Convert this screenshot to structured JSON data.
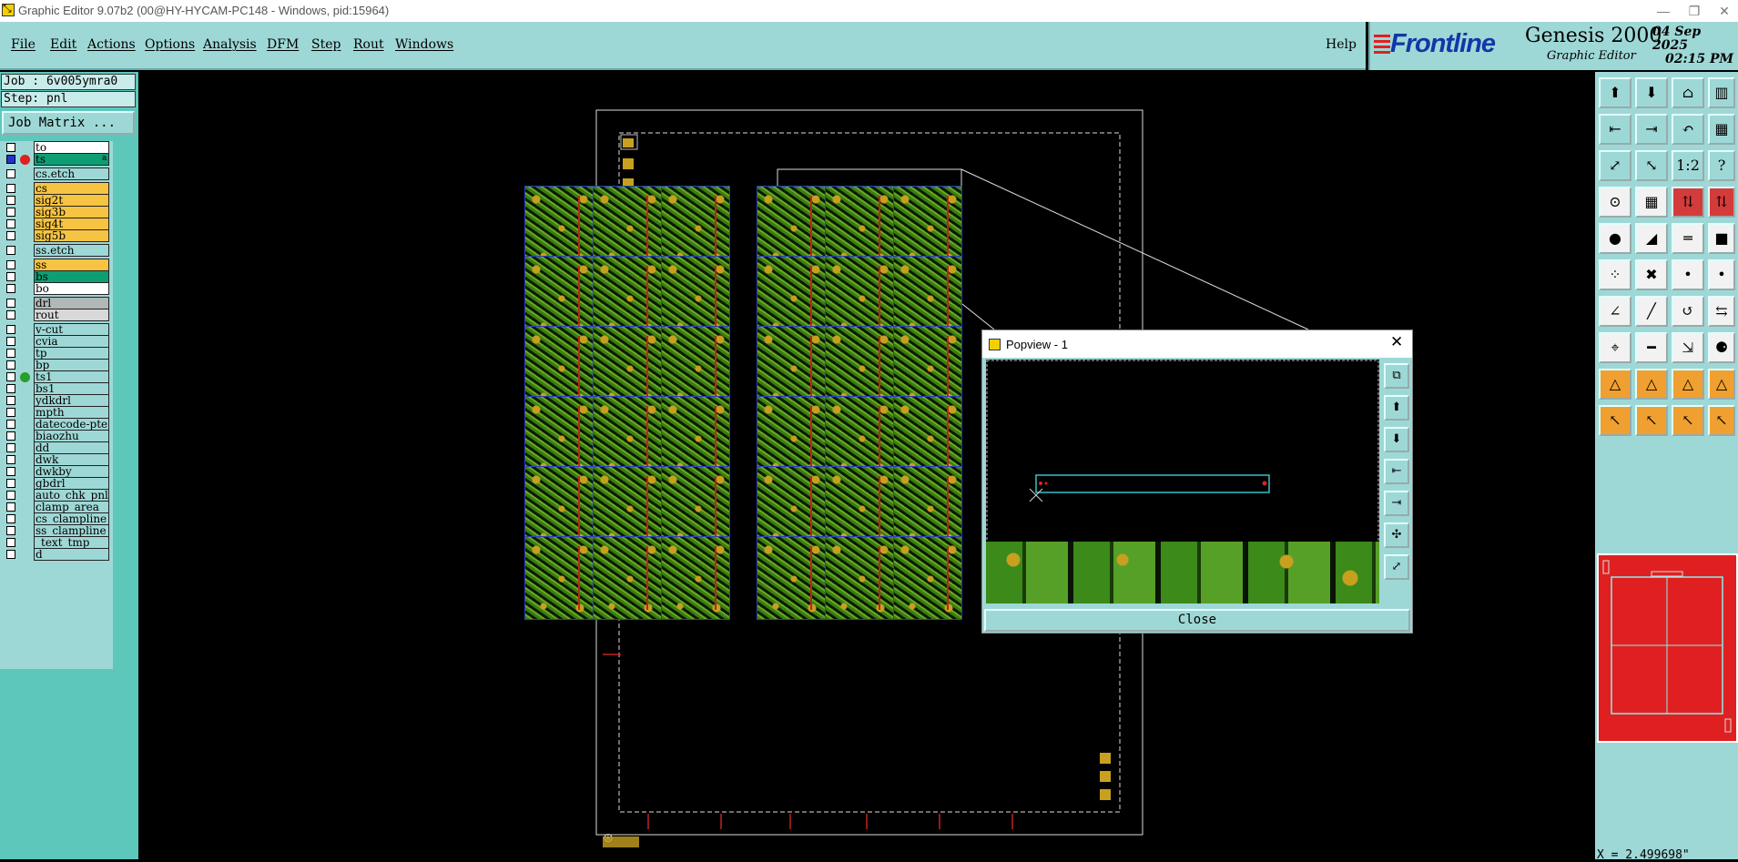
{
  "window": {
    "title": "Graphic Editor 9.07b2 (00@HY-HYCAM-PC148 - Windows, pid:15964)",
    "minimize_glyph": "—",
    "restore_glyph": "❐",
    "close_glyph": "✕"
  },
  "menu": {
    "items": [
      "File",
      "Edit",
      "Actions",
      "Options",
      "Analysis",
      "DFM",
      "Step",
      "Rout",
      "Windows"
    ],
    "help": "Help"
  },
  "brand": {
    "logo": "Frontline",
    "product": "Genesis 2000",
    "subtitle": "Graphic Editor",
    "date": "04 Sep 2025",
    "time": "02:15 PM"
  },
  "job": {
    "job_line": "Job : 6v005ymra0",
    "step_line": "Step: pnl",
    "matrix_button": "Job Matrix ..."
  },
  "layers": [
    {
      "name": "to",
      "color": "#ffffff",
      "checked": false
    },
    {
      "name": "ts",
      "color": "#0f9e74",
      "checked": true,
      "dot": "#e02020",
      "indicator": "a"
    },
    {
      "name": "cs.etch",
      "color": "#9ed8d6",
      "checked": false
    },
    {
      "name": "cs",
      "color": "#f6c442",
      "checked": false
    },
    {
      "name": "sig2t",
      "color": "#f6c442",
      "checked": false
    },
    {
      "name": "sig3b",
      "color": "#f6c442",
      "checked": false
    },
    {
      "name": "sig4t",
      "color": "#f6c442",
      "checked": false
    },
    {
      "name": "sig5b",
      "color": "#f6c442",
      "checked": false
    },
    {
      "name": "ss.etch",
      "color": "#9ed8d6",
      "checked": false
    },
    {
      "name": "ss",
      "color": "#f6c442",
      "checked": false
    },
    {
      "name": "bs",
      "color": "#0f9e74",
      "checked": false
    },
    {
      "name": "bo",
      "color": "#ffffff",
      "checked": false
    },
    {
      "name": "drl",
      "color": "#b0b8b8",
      "checked": false
    },
    {
      "name": "rout",
      "color": "#d8d8d8",
      "checked": false
    },
    {
      "name": "v-cut",
      "color": "#9ed8d6",
      "checked": false
    },
    {
      "name": "cvia",
      "color": "#9ed8d6",
      "checked": false
    },
    {
      "name": "tp",
      "color": "#9ed8d6",
      "checked": false
    },
    {
      "name": "bp",
      "color": "#9ed8d6",
      "checked": false
    },
    {
      "name": "ts1",
      "color": "#9ed8d6",
      "checked": false,
      "dot": "#2a9d2a"
    },
    {
      "name": "bs1",
      "color": "#9ed8d6",
      "checked": false
    },
    {
      "name": "ydkdrl",
      "color": "#9ed8d6",
      "checked": false
    },
    {
      "name": "mpth",
      "color": "#9ed8d6",
      "checked": false
    },
    {
      "name": "datecode-pte",
      "color": "#9ed8d6",
      "checked": false
    },
    {
      "name": "biaozhu",
      "color": "#9ed8d6",
      "checked": false
    },
    {
      "name": "dd",
      "color": "#9ed8d6",
      "checked": false
    },
    {
      "name": "dwk",
      "color": "#9ed8d6",
      "checked": false
    },
    {
      "name": "dwkby",
      "color": "#9ed8d6",
      "checked": false
    },
    {
      "name": "gbdrl",
      "color": "#9ed8d6",
      "checked": false
    },
    {
      "name": "auto_chk_pnl",
      "color": "#9ed8d6",
      "checked": false
    },
    {
      "name": "clamp_area",
      "color": "#9ed8d6",
      "checked": false
    },
    {
      "name": "cs_clampline",
      "color": "#9ed8d6",
      "checked": false
    },
    {
      "name": "ss_clampline",
      "color": "#9ed8d6",
      "checked": false
    },
    {
      "name": "_text_tmp",
      "color": "#9ed8d6",
      "checked": false
    },
    {
      "name": "d",
      "color": "#9ed8d6",
      "checked": false
    }
  ],
  "popview": {
    "title": "Popview - 1",
    "close_glyph": "✕",
    "close_button": "Close"
  },
  "toolbar_icons": [
    "zoom-home-icon",
    "zoom-fit-icon",
    "home-icon",
    "window-icon",
    "pan-left-icon",
    "pan-right-icon",
    "zoom-back-icon",
    "grid-icon",
    "fit-profile-icon",
    "fit-screen-icon",
    "scale-1-2-icon",
    "help-icon",
    "snap-icon",
    "grid-toggle-icon",
    "layer-red-icon",
    "layer-red2-icon",
    "camera-icon",
    "arc-icon",
    "ruler-icon",
    "pad-icon",
    "connect-icon",
    "cross-icon",
    "point-icon",
    "point2-icon",
    "angle-icon",
    "line-icon",
    "rotate-icon",
    "flip-icon",
    "measure-icon",
    "bar-icon",
    "resize-icon",
    "shape-icon",
    "triangle-icon",
    "triangle2-icon",
    "triangle3-icon",
    "triangle4-icon",
    "select-icon",
    "select2-icon",
    "select3-icon",
    "select4-icon"
  ],
  "toolbar_glyphs": [
    "⬆",
    "⬇",
    "⌂",
    "▥",
    "⇤",
    "⇥",
    "↶",
    "▦",
    "⤢",
    "⤡",
    "1:2",
    "?",
    "⊙",
    "▦",
    "⇅",
    "⇅",
    "●",
    "◢",
    "═",
    "■",
    "⁘",
    "✖",
    "•",
    "•",
    "∠",
    "╱",
    "↺",
    "⇆",
    "⌖",
    "━",
    "⇲",
    "⚈",
    "△",
    "△",
    "△",
    "△",
    "↖",
    "↖",
    "↖",
    "↖"
  ],
  "popview_tools": [
    "⧉",
    "⬆",
    "⬇",
    "⇤",
    "⇥",
    "✣",
    "⤢"
  ],
  "coordinate": "X = 2.499698\""
}
